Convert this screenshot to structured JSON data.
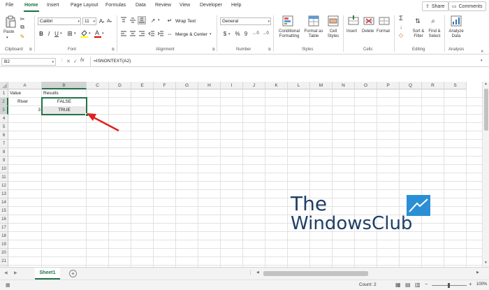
{
  "menu": {
    "items": [
      "File",
      "Home",
      "Insert",
      "Page Layout",
      "Formulas",
      "Data",
      "Review",
      "View",
      "Developer",
      "Help"
    ],
    "active": "Home",
    "share_label": "Share",
    "comments_label": "Comments"
  },
  "ribbon": {
    "clipboard": {
      "paste_label": "Paste",
      "group_label": "Clipboard"
    },
    "font": {
      "font_name": "Calibri",
      "font_size": "11",
      "group_label": "Font",
      "bold": "B",
      "italic": "I",
      "underline": "U",
      "grow": "A",
      "shrink": "A"
    },
    "alignment": {
      "wrap_text_label": "Wrap Text",
      "merge_center_label": "Merge & Center",
      "group_label": "Alignment"
    },
    "number": {
      "format": "General",
      "currency": "$",
      "percent": "%",
      "comma": "9",
      "group_label": "Number"
    },
    "styles": {
      "conditional_label": "Conditional\nFormatting",
      "format_table_label": "Format as\nTable",
      "cell_styles_label": "Cell\nStyles",
      "group_label": "Styles"
    },
    "cells": {
      "insert_label": "Insert",
      "delete_label": "Delete",
      "format_label": "Format",
      "group_label": "Cells"
    },
    "editing": {
      "sort_filter_label": "Sort &\nFilter",
      "find_select_label": "Find &\nSelect",
      "group_label": "Editing"
    },
    "analysis": {
      "analyze_label": "Analyze\nData",
      "group_label": "Analysis"
    }
  },
  "formula_bar": {
    "name_box": "B2",
    "fx_label": "fx",
    "formula": "=ISNONTEXT(A2)"
  },
  "grid": {
    "columns": [
      "A",
      "B",
      "C",
      "D",
      "E",
      "F",
      "G",
      "H",
      "I",
      "J",
      "K",
      "L",
      "M",
      "N",
      "O",
      "P",
      "Q",
      "R",
      "S"
    ],
    "rows": [
      "1",
      "2",
      "3",
      "4",
      "5",
      "6",
      "7",
      "8",
      "9",
      "10",
      "11",
      "12",
      "13",
      "14",
      "15",
      "16",
      "17",
      "18",
      "19",
      "20",
      "21",
      "22"
    ],
    "cells": {
      "A1": "Value",
      "B1": "Results",
      "A2": "River",
      "B2": "FALSE",
      "A3": "3",
      "B3": "TRUE"
    }
  },
  "watermark": {
    "line1": "The",
    "line2": "WindowsClub"
  },
  "sheets": {
    "tabs": [
      "Sheet1"
    ],
    "active": "Sheet1"
  },
  "status": {
    "count": "Count: 2",
    "zoom_label": "100%"
  }
}
